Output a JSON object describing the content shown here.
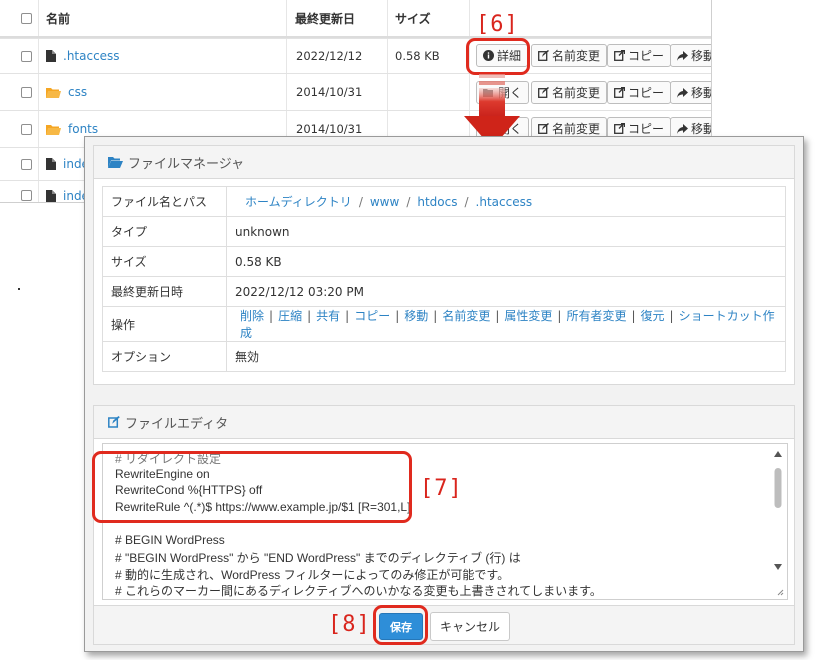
{
  "file_list": {
    "columns": {
      "name": "名前",
      "modified": "最終更新日",
      "size": "サイズ"
    },
    "rows": [
      {
        "name": ".htaccess",
        "type": "file",
        "date": "2022/12/12",
        "size": "0.58 KB"
      },
      {
        "name": "css",
        "type": "folder",
        "date": "2014/10/31",
        "size": ""
      },
      {
        "name": "fonts",
        "type": "folder",
        "date": "2014/10/31",
        "size": ""
      },
      {
        "name": "inde",
        "type": "file",
        "date": "",
        "size": ""
      },
      {
        "name": "inde",
        "type": "file",
        "date": "",
        "size": ""
      }
    ],
    "actions": {
      "detail": "詳細",
      "open": "開く",
      "rename": "名前変更",
      "copy": "コピー",
      "move": "移動"
    }
  },
  "callouts": {
    "c6": "[6]",
    "c7": "[7]",
    "c8": "[8]"
  },
  "file_manager": {
    "title": "ファイルマネージャ",
    "labels": {
      "path": "ファイル名とパス",
      "type": "タイプ",
      "size": "サイズ",
      "modified": "最終更新日時",
      "operations": "操作",
      "options": "オプション"
    },
    "path": [
      "ホームディレクトリ",
      "www",
      "htdocs",
      ".htaccess"
    ],
    "path_separator": "/",
    "type": "unknown",
    "size": "0.58 KB",
    "modified": "2022/12/12 03:20 PM",
    "operations": [
      "削除",
      "圧縮",
      "共有",
      "コピー",
      "移動",
      "名前変更",
      "属性変更",
      "所有者変更",
      "復元",
      "ショートカット作成"
    ],
    "operations_separator": "|",
    "options": "無効"
  },
  "file_editor": {
    "title": "ファイルエディタ",
    "lines": [
      "# リダイレクト設定",
      "RewriteEngine on",
      "RewriteCond %{HTTPS} off",
      "RewriteRule ^(.*)$ https://www.example.jp/$1 [R=301,L]",
      "",
      "# BEGIN WordPress",
      "# \"BEGIN WordPress\" から \"END WordPress\" までのディレクティブ (行) は",
      "# 動的に生成され、WordPress フィルターによってのみ修正が可能です。",
      "# これらのマーカー間にあるディレクティブへのいかなる変更も上書きされてしまいます。"
    ],
    "save": "保存",
    "cancel": "キャンセル"
  },
  "colors": {
    "link": "#2d83c4",
    "accent": "#2e8ed8",
    "callout": "#e02a1e",
    "folder": "#f5a623"
  },
  "icons": [
    "file-icon",
    "folder-icon",
    "info-icon",
    "edit-icon",
    "copy-icon",
    "share-icon",
    "folder-open-icon"
  ]
}
